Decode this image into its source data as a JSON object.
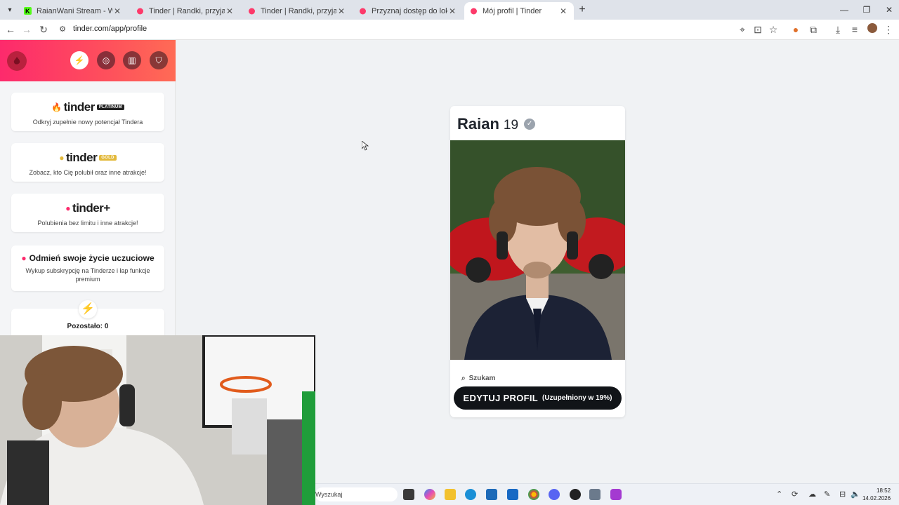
{
  "browser": {
    "tabs": [
      {
        "title": "RaianWani Stream - Watch Live",
        "favicon": "kick-icon",
        "active": false
      },
      {
        "title": "Tinder | Randki, przyjaźni, nowe",
        "favicon": "tinder-flame-icon",
        "active": false
      },
      {
        "title": "Tinder | Randki, przyjaźni, nowe",
        "favicon": "tinder-flame-icon",
        "active": false
      },
      {
        "title": "Przyznaj dostęp do lokalizacji u",
        "favicon": "tinder-flame-icon",
        "active": false
      },
      {
        "title": "Mój profil | Tinder",
        "favicon": "tinder-flame-icon",
        "active": true
      }
    ],
    "url": "tinder.com/app/profile"
  },
  "sidebar": {
    "cards": [
      {
        "brand": "tinder",
        "tier": "PLATINUM",
        "text": "Odkryj zupełnie nowy potencjał Tindera"
      },
      {
        "brand": "tinder",
        "tier": "GOLD",
        "text": "Zobacz, kto Cię polubił oraz inne atrakcje!"
      },
      {
        "brand": "tinder+",
        "tier": "",
        "text": "Polubienia bez limitu i inne atrakcje!"
      },
      {
        "heading": "Odmień swoje życie uczuciowe",
        "text": "Wykup subskrypcję na Tinderze i łap funkcje premium"
      }
    ],
    "boost": {
      "remaining": "Pozostało: 0"
    }
  },
  "profile": {
    "name": "Raian",
    "age": "19",
    "search_label": "Szukam",
    "edit_label": "EDYTUJ PROFIL",
    "completion": "(Uzupełniony w 19%)"
  },
  "taskbar": {
    "search_placeholder": "Wyszukaj",
    "time": "18:52",
    "date": "14.02.2026"
  },
  "colors": {
    "tinder_gradient_start": "#fd2a6c",
    "tinder_gradient_end": "#ff6b55",
    "edit_button": "#111418"
  }
}
